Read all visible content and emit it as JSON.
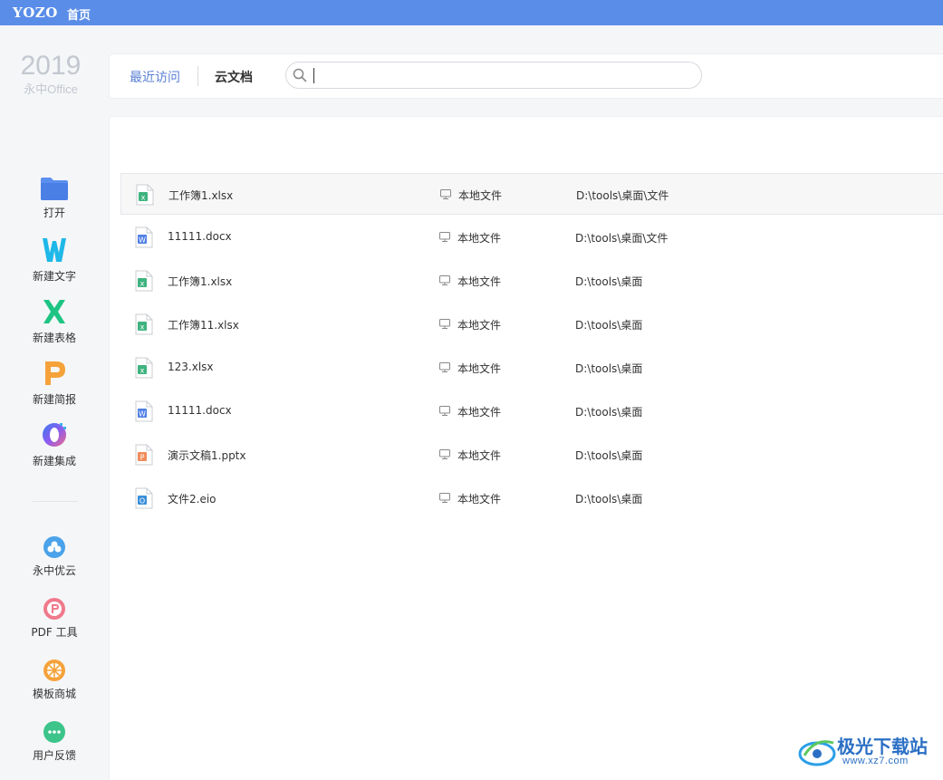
{
  "titlebar": {
    "logo": "YOZO",
    "home": "首页",
    "color": "#5a8de8"
  },
  "brand": {
    "year": "2019",
    "sub": "永中Office"
  },
  "sidebar": {
    "actions": [
      {
        "label": "打开",
        "icon": "folder-icon"
      },
      {
        "label": "新建文字",
        "icon": "writer-w-icon"
      },
      {
        "label": "新建表格",
        "icon": "sheet-x-icon"
      },
      {
        "label": "新建简报",
        "icon": "presentation-p-icon"
      },
      {
        "label": "新建集成",
        "icon": "integration-o-icon"
      }
    ],
    "services": [
      {
        "label": "永中优云",
        "icon": "cloud-icon"
      },
      {
        "label": "PDF 工具",
        "icon": "pdf-icon"
      },
      {
        "label": "模板商城",
        "icon": "template-store-icon"
      },
      {
        "label": "用户反馈",
        "icon": "feedback-icon"
      }
    ]
  },
  "tabs": {
    "recent": "最近访问",
    "cloud": "云文档"
  },
  "search": {
    "placeholder": "",
    "value": ""
  },
  "files": [
    {
      "name": "工作簿1.xlsx",
      "type": "xlsx",
      "location": "本地文件",
      "path": "D:\\tools\\桌面\\文件"
    },
    {
      "name": "11111.docx",
      "type": "docx",
      "location": "本地文件",
      "path": "D:\\tools\\桌面\\文件"
    },
    {
      "name": "工作簿1.xlsx",
      "type": "xlsx",
      "location": "本地文件",
      "path": "D:\\tools\\桌面"
    },
    {
      "name": "工作簿11.xlsx",
      "type": "xlsx",
      "location": "本地文件",
      "path": "D:\\tools\\桌面"
    },
    {
      "name": "123.xlsx",
      "type": "xlsx",
      "location": "本地文件",
      "path": "D:\\tools\\桌面"
    },
    {
      "name": "11111.docx",
      "type": "docx",
      "location": "本地文件",
      "path": "D:\\tools\\桌面"
    },
    {
      "name": "演示文稿1.pptx",
      "type": "pptx",
      "location": "本地文件",
      "path": "D:\\tools\\桌面"
    },
    {
      "name": "文件2.eio",
      "type": "eio",
      "location": "本地文件",
      "path": "D:\\tools\\桌面"
    }
  ],
  "file_type_colors": {
    "xlsx": "#3fb37f",
    "docx": "#4f7fe6",
    "pptx": "#f08b5b",
    "eio": "#3a8fd9"
  },
  "file_type_letters": {
    "xlsx": "x",
    "docx": "W",
    "pptx": "P",
    "eio": "O"
  },
  "watermark": {
    "title": "极光下载站",
    "url": "www.xz7.com"
  }
}
